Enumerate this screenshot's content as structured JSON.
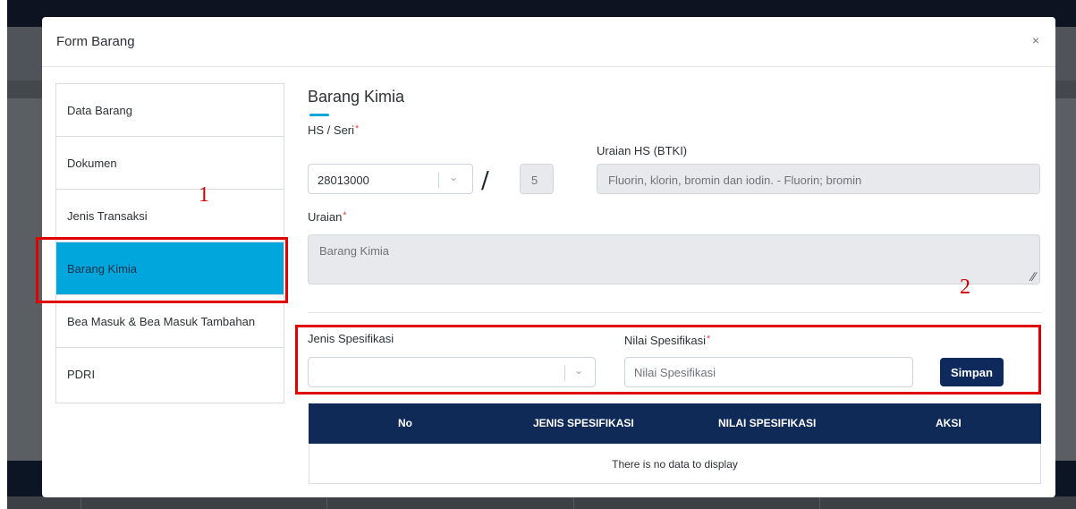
{
  "modal": {
    "title": "Form Barang",
    "close_label": "×"
  },
  "sidebar": {
    "items": [
      {
        "label": "Data Barang"
      },
      {
        "label": "Dokumen"
      },
      {
        "label": "Jenis Transaksi"
      },
      {
        "label": "Barang Kimia",
        "active": true
      },
      {
        "label": "Bea Masuk & Bea Masuk Tambahan"
      },
      {
        "label": "PDRI"
      }
    ]
  },
  "section": {
    "title": "Barang Kimia"
  },
  "form": {
    "hs_label": "HS / Seri",
    "required_mark": "*",
    "hs_value": "28013000",
    "separator": "/",
    "seri_value": "5",
    "uraian_hs_label": "Uraian HS (BTKI)",
    "uraian_hs_value": "Fluorin, klorin, bromin dan iodin. - Fluorin; bromin",
    "uraian_label": "Uraian",
    "uraian_value": "Barang Kimia"
  },
  "spec": {
    "jenis_label": "Jenis Spesifikasi",
    "jenis_value": "",
    "nilai_label": "Nilai Spesifikasi",
    "nilai_placeholder": "Nilai Spesifikasi",
    "save_label": "Simpan"
  },
  "table": {
    "columns": [
      "No",
      "JENIS SPESIFIKASI",
      "NILAI SPESIFIKASI",
      "AKSI"
    ],
    "rows": [],
    "empty_message": "There is no data to display"
  },
  "annotations": {
    "label_1": "1",
    "label_2": "2",
    "color": "#e00000"
  },
  "colors": {
    "accent": "#00a6dc",
    "header_navy": "#0f2a57",
    "button_navy": "#0e2a5c"
  }
}
